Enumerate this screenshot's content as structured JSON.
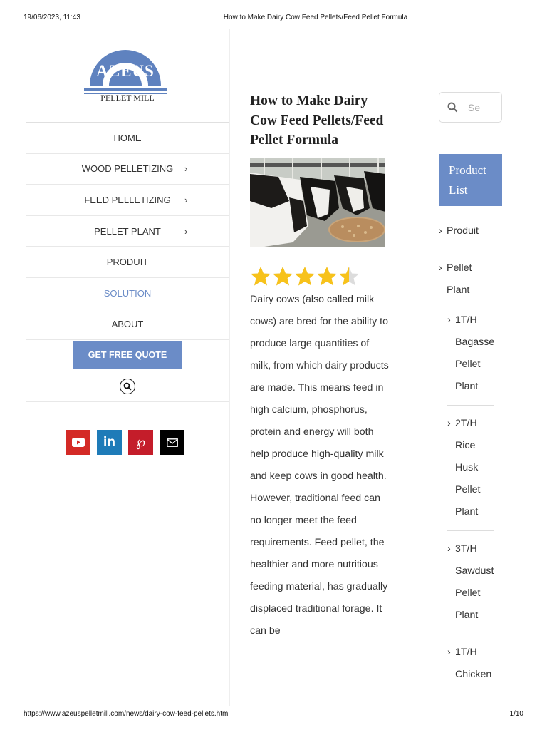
{
  "print": {
    "datetime": "19/06/2023, 11:43",
    "doc_title": "How to Make Dairy Cow Feed Pellets/Feed Pellet Formula",
    "url": "https://www.azeuspelletmill.com/news/dairy-cow-feed-pellets.html",
    "page": "1/10"
  },
  "brand": {
    "logo_text": "AZEUS",
    "tagline": "PELLET MILL",
    "color": "#5f82bf"
  },
  "menu": {
    "items": [
      {
        "label": "HOME"
      },
      {
        "label": "WOOD PELLETIZING"
      },
      {
        "label": "FEED PELLETIZING"
      },
      {
        "label": "PELLET PLANT"
      },
      {
        "label": "PRODUIT"
      },
      {
        "label": "SOLUTION"
      },
      {
        "label": "ABOUT"
      }
    ],
    "quote_button": "GET FREE QUOTE",
    "active_color": "#6b8cc7"
  },
  "socials": [
    "youtube-icon",
    "linkedin-icon",
    "pinterest-icon",
    "email-icon"
  ],
  "article": {
    "title": "How to Make Dairy Cow Feed Pellets/Feed Pellet Formula",
    "rating": 4.5,
    "rating_max": 5,
    "body": "Dairy cows (also called milk cows) are bred for the ability to produce large quantities of milk, from which dairy products are made. This means feed in high calcium, phosphorus, protein and energy will both help produce high-quality milk and keep cows in good health. However, traditional feed can no longer meet the feed requirements. Feed pellet, the healthier and more nutritious feeding material, has gradually displaced traditional forage. It can be"
  },
  "right": {
    "search_placeholder": "Se",
    "product_list_label": "Product List",
    "links": [
      {
        "label": "Produit"
      },
      {
        "label": "Pellet Plant"
      }
    ],
    "sub_links": [
      {
        "label": "1T/H Bagasse Pellet Plant"
      },
      {
        "label": "2T/H Rice Husk Pellet Plant"
      },
      {
        "label": "3T/H Sawdust Pellet Plant"
      },
      {
        "label": "1T/H Chicken"
      }
    ]
  }
}
